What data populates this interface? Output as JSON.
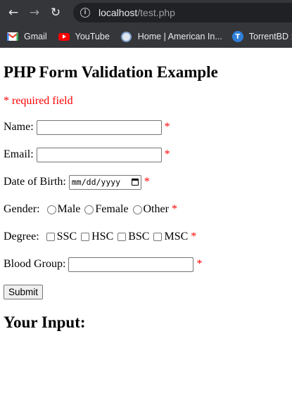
{
  "browser": {
    "url_host": "localhost",
    "url_path": "/test.php",
    "bookmarks": [
      {
        "label": "Gmail",
        "icon": "gmail-icon"
      },
      {
        "label": "YouTube",
        "icon": "youtube-icon"
      },
      {
        "label": "Home | American In...",
        "icon": "american-icon"
      },
      {
        "label": "TorrentBD : H",
        "icon": "torrentbd-icon"
      }
    ],
    "colors": {
      "chrome": "#35363a",
      "omnibox": "#202124"
    }
  },
  "page": {
    "title": "PHP Form Validation Example",
    "required_note": "* required field",
    "asterisk": "*",
    "fields": {
      "name": {
        "label": "Name:",
        "value": ""
      },
      "email": {
        "label": "Email:",
        "value": ""
      },
      "dob": {
        "label": "Date of Birth:",
        "placeholder": "mm/dd/yyyy"
      },
      "gender": {
        "label": "Gender:",
        "options": [
          "Male",
          "Female",
          "Other"
        ]
      },
      "degree": {
        "label": "Degree:",
        "options": [
          "SSC",
          "HSC",
          "BSC",
          "MSC"
        ]
      },
      "blood_group": {
        "label": "Blood Group:",
        "value": ""
      }
    },
    "submit_label": "Submit",
    "output_heading": "Your Input:",
    "colors": {
      "required": "#ff0000"
    }
  }
}
